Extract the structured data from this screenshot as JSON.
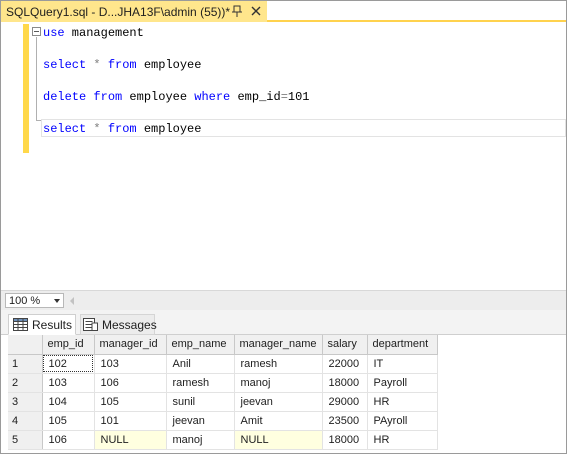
{
  "tab": {
    "title": "SQLQuery1.sql - D...JHA13F\\admin (55))*"
  },
  "editor": {
    "lines": [
      {
        "kw1": "use",
        "rest": " management"
      },
      {
        "kw1": "select",
        "op": " * ",
        "kw2": "from",
        "rest": " employee"
      },
      {
        "kw1": "delete",
        "sp1": " ",
        "kw2": "from",
        "mid": " employee ",
        "kw3": "where",
        "rest2": " emp_id",
        "op": "=",
        "num": "101"
      },
      {
        "kw1": "select",
        "op": " * ",
        "kw2": "from",
        "rest": " employee"
      }
    ]
  },
  "zoom": {
    "value": "100 %"
  },
  "result_tabs": {
    "results_label": "Results",
    "messages_label": "Messages"
  },
  "grid": {
    "columns": [
      "emp_id",
      "manager_id",
      "emp_name",
      "manager_name",
      "salary",
      "department"
    ],
    "rows": [
      {
        "num": "1",
        "emp_id": "102",
        "manager_id": "103",
        "emp_name": "Anil",
        "manager_name": "ramesh",
        "salary": "22000",
        "department": "IT"
      },
      {
        "num": "2",
        "emp_id": "103",
        "manager_id": "106",
        "emp_name": "ramesh",
        "manager_name": "manoj",
        "salary": "18000",
        "department": "Payroll"
      },
      {
        "num": "3",
        "emp_id": "104",
        "manager_id": "105",
        "emp_name": "sunil",
        "manager_name": "jeevan",
        "salary": "29000",
        "department": "HR"
      },
      {
        "num": "4",
        "emp_id": "105",
        "manager_id": "101",
        "emp_name": "jeevan",
        "manager_name": "Amit",
        "salary": "23500",
        "department": "PAyroll"
      },
      {
        "num": "5",
        "emp_id": "106",
        "manager_id": "NULL",
        "emp_name": "manoj",
        "manager_name": "NULL",
        "salary": "18000",
        "department": "HR"
      }
    ]
  },
  "colors": {
    "tab_active": "#ffe68c",
    "tab_underline": "#ffd24d",
    "keyword": "#0000ff",
    "null_cell": "#ffffe0"
  }
}
